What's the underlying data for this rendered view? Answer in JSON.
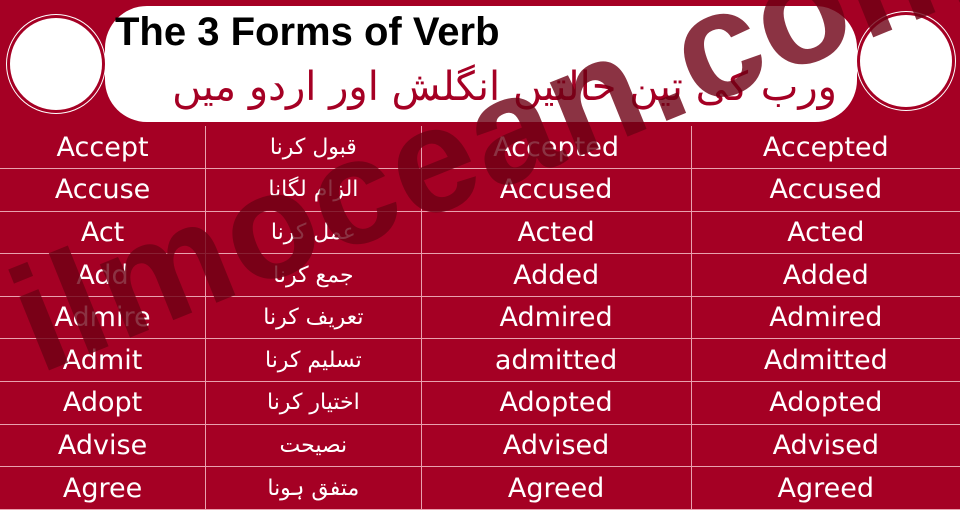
{
  "header": {
    "title": "The 3 Forms of Verb",
    "subtitle": "ورب کی تین حالتیں انگلش اور اردو میں"
  },
  "watermark": "ilmocean.com",
  "rows": [
    [
      "Accept",
      "قبول کرنا",
      "Accepted",
      "Accepted"
    ],
    [
      "Accuse",
      "الزام لگانا",
      "Accused",
      "Accused"
    ],
    [
      "Act",
      "عمل کرنا",
      "Acted",
      "Acted"
    ],
    [
      "Add",
      "جمع کرنا",
      "Added",
      "Added"
    ],
    [
      "Admire",
      "تعریف کرنا",
      "Admired",
      "Admired"
    ],
    [
      "Admit",
      "تسلیم کرنا",
      "admitted",
      "Admitted"
    ],
    [
      "Adopt",
      "اختیار کرنا",
      "Adopted",
      "Adopted"
    ],
    [
      "Advise",
      "نصیحت",
      "Advised",
      "Advised"
    ],
    [
      "Agree",
      "متفق ہونا",
      "Agreed",
      "Agreed"
    ]
  ],
  "colors": {
    "background": "#a50024",
    "header": "#ffffff"
  }
}
